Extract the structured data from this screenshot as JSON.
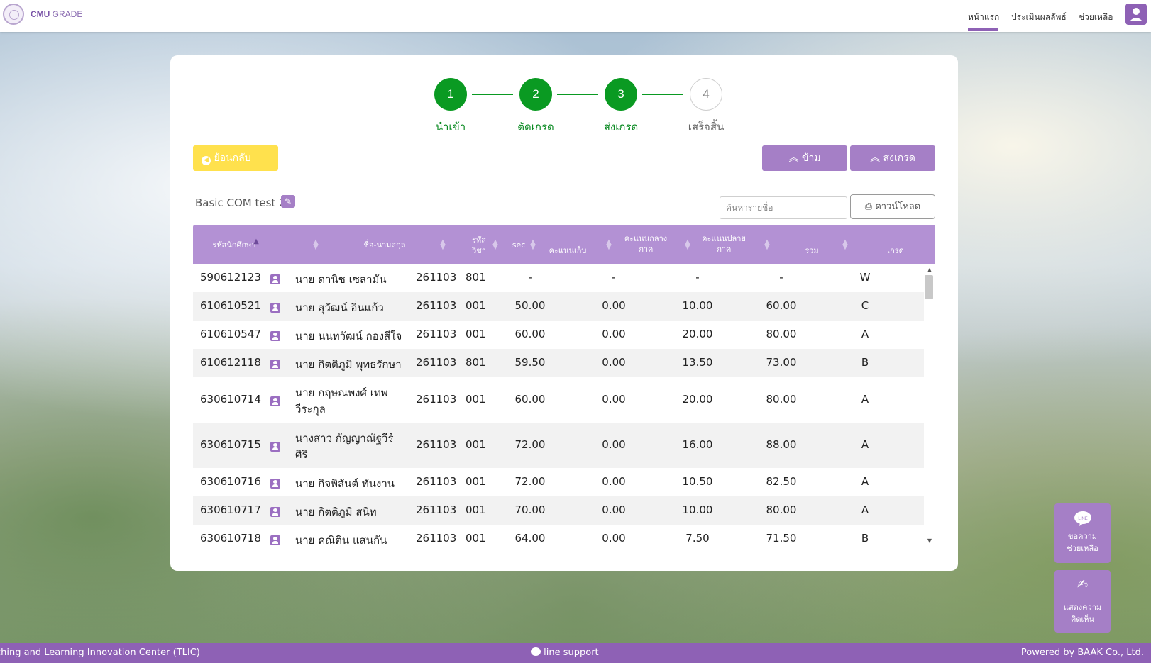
{
  "brand": {
    "name": "CMU",
    "suffix": "GRADE"
  },
  "nav": {
    "home": "หน้าแรก",
    "evaluate": "ประเมินผลลัพธ์",
    "help": "ช่วยเหลือ"
  },
  "stepper": [
    {
      "num": "1",
      "label": "นำเข้า",
      "state": "done"
    },
    {
      "num": "2",
      "label": "ตัดเกรด",
      "state": "done"
    },
    {
      "num": "3",
      "label": "ส่งเกรด",
      "state": "done"
    },
    {
      "num": "4",
      "label": "เสร็จสิ้น",
      "state": "todo"
    }
  ],
  "actions": {
    "back": "ย้อนกลับ",
    "skip": "ข้าม",
    "send": "ส่งเกรด",
    "download": "ดาวน์โหลด"
  },
  "course": {
    "name": "Basic COM test 2"
  },
  "search": {
    "placeholder": "ค้นหารายชื่อ"
  },
  "table": {
    "headers": {
      "student_id": "รหัสนักศึกษา",
      "name": "ชื่อ-นามสกุล",
      "course_code_1": "รหัส",
      "course_code_2": "วิชา",
      "sec": "sec",
      "collected": "คะแนนเก็บ",
      "mid_1": "คะแนนกลาง",
      "mid_2": "ภาค",
      "final_1": "คะแนนปลาย",
      "final_2": "ภาค",
      "total": "รวม",
      "grade": "เกรด"
    },
    "rows": [
      {
        "id": "590612123",
        "name1": "นาย ดานิช เซลามัน",
        "name2": "",
        "code": "261103",
        "sec": "801",
        "collected": "-",
        "mid": "-",
        "final": "-",
        "total": "-",
        "grade": "W"
      },
      {
        "id": "610610521",
        "name1": "นาย สุวัฒน์ อิ่นแก้ว",
        "name2": "",
        "code": "261103",
        "sec": "001",
        "collected": "50.00",
        "mid": "0.00",
        "final": "10.00",
        "total": "60.00",
        "grade": "C"
      },
      {
        "id": "610610547",
        "name1": "นาย นนทวัฒน์ กองสีใจ",
        "name2": "",
        "code": "261103",
        "sec": "001",
        "collected": "60.00",
        "mid": "0.00",
        "final": "20.00",
        "total": "80.00",
        "grade": "A"
      },
      {
        "id": "610612118",
        "name1": "นาย กิตติภูมิ พุทธรักษา",
        "name2": "",
        "code": "261103",
        "sec": "801",
        "collected": "59.50",
        "mid": "0.00",
        "final": "13.50",
        "total": "73.00",
        "grade": "B"
      },
      {
        "id": "630610714",
        "name1": "นาย กฤษณพงศ์ เทพ",
        "name2": "วีระกุล",
        "code": "261103",
        "sec": "001",
        "collected": "60.00",
        "mid": "0.00",
        "final": "20.00",
        "total": "80.00",
        "grade": "A"
      },
      {
        "id": "630610715",
        "name1": "นางสาว กัญญาณัฐวีร์",
        "name2": "ศิริ",
        "code": "261103",
        "sec": "001",
        "collected": "72.00",
        "mid": "0.00",
        "final": "16.00",
        "total": "88.00",
        "grade": "A"
      },
      {
        "id": "630610716",
        "name1": "นาย กิจพิสันต์ ทันงาน",
        "name2": "",
        "code": "261103",
        "sec": "001",
        "collected": "72.00",
        "mid": "0.00",
        "final": "10.50",
        "total": "82.50",
        "grade": "A"
      },
      {
        "id": "630610717",
        "name1": "นาย กิตติภูมิ สนิท",
        "name2": "",
        "code": "261103",
        "sec": "001",
        "collected": "70.00",
        "mid": "0.00",
        "final": "10.00",
        "total": "80.00",
        "grade": "A"
      },
      {
        "id": "630610718",
        "name1": "นาย คณิติน แสนกัน",
        "name2": "",
        "code": "261103",
        "sec": "001",
        "collected": "64.00",
        "mid": "0.00",
        "final": "7.50",
        "total": "71.50",
        "grade": "B"
      }
    ]
  },
  "floating": {
    "line_help_1": "ขอความ",
    "line_help_2": "ช่วยเหลือ",
    "line_badge": "LINE",
    "feedback_1": "แสดงความ",
    "feedback_2": "คิดเห็น"
  },
  "footer": {
    "left": "ching and Learning Innovation Center (TLIC)",
    "center": "line support",
    "right": "Powered by BAAK Co., Ltd."
  },
  "colors": {
    "purple": "#8e61b5",
    "header_purple": "#b391d4",
    "green": "#0a9a22",
    "yellow": "#ffe14d"
  }
}
